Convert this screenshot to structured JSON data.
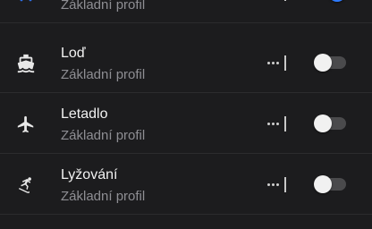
{
  "colors": {
    "background": "#1c1c1e",
    "accent": "#2e7bff"
  },
  "profiles": [
    {
      "icon": "bus-icon",
      "name": "",
      "subtitle": "Základní profil",
      "enabled": true
    },
    {
      "icon": "boat-icon",
      "name": "Loď",
      "subtitle": "Základní profil",
      "enabled": false
    },
    {
      "icon": "airplane-icon",
      "name": "Letadlo",
      "subtitle": "Základní profil",
      "enabled": false
    },
    {
      "icon": "skiing-icon",
      "name": "Lyžování",
      "subtitle": "Základní profil",
      "enabled": false
    }
  ]
}
